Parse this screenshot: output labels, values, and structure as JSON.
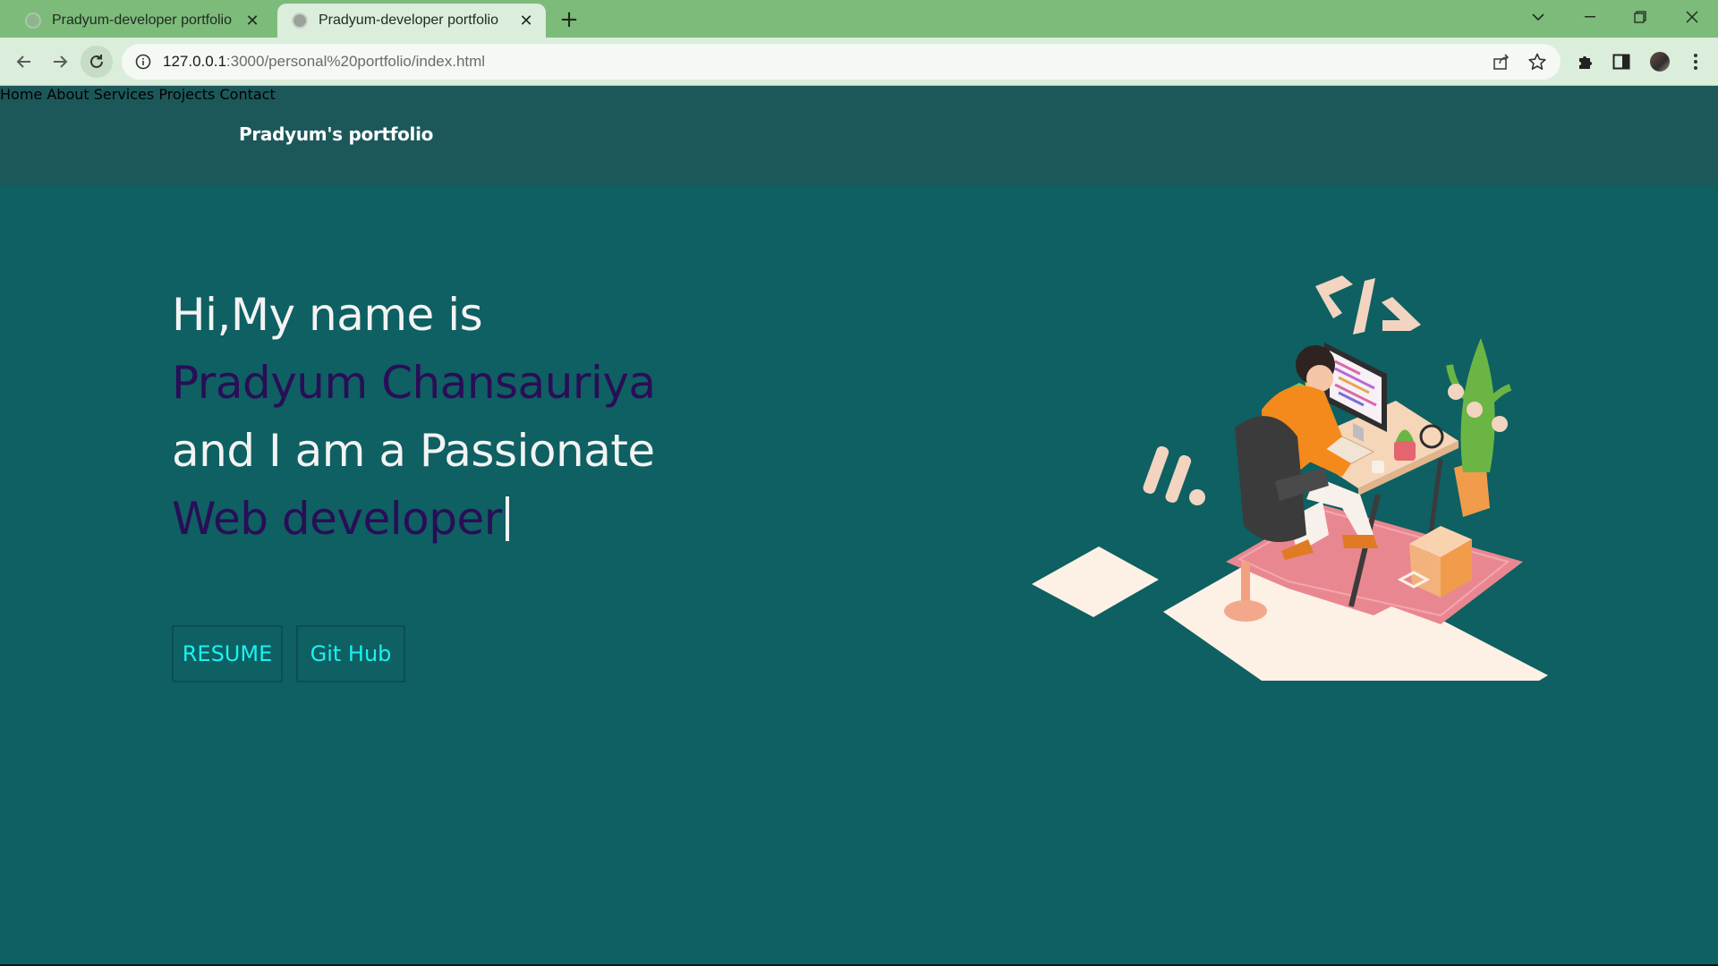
{
  "browser": {
    "tabs": [
      {
        "title": "Pradyum-developer portfolio",
        "active": false
      },
      {
        "title": "Pradyum-developer portfolio",
        "active": true
      }
    ],
    "address": {
      "host": "127.0.0.1",
      "path": ":3000/personal%20portfolio/index.html"
    },
    "icons": {
      "back": "arrow-left-icon",
      "forward": "arrow-right-icon",
      "reload": "reload-icon",
      "info": "info-icon",
      "share": "share-icon",
      "bookmark": "star-icon",
      "extensions": "puzzle-icon",
      "sidepanel": "side-panel-icon",
      "menu": "kebab-menu-icon"
    },
    "colors": {
      "tabbar": "#7dbb7b",
      "toolbar": "#dbeddb"
    }
  },
  "site": {
    "logo": "Pradyum's portfolio",
    "nav": [
      "Home",
      "About",
      "Services",
      "Projects",
      "Contact"
    ],
    "hero": {
      "line1": "Hi,My name is",
      "name": "Pradyum Chansauriya",
      "line3": "and I am a Passionate",
      "role": "Web developer"
    },
    "buttons": {
      "resume": "RESUME",
      "github": "Git Hub"
    },
    "colors": {
      "header_bg": "#1c5859",
      "hero_bg": "#0e6062",
      "accent_purple": "#2a0d57",
      "button_text": "#1ef0f0"
    }
  }
}
